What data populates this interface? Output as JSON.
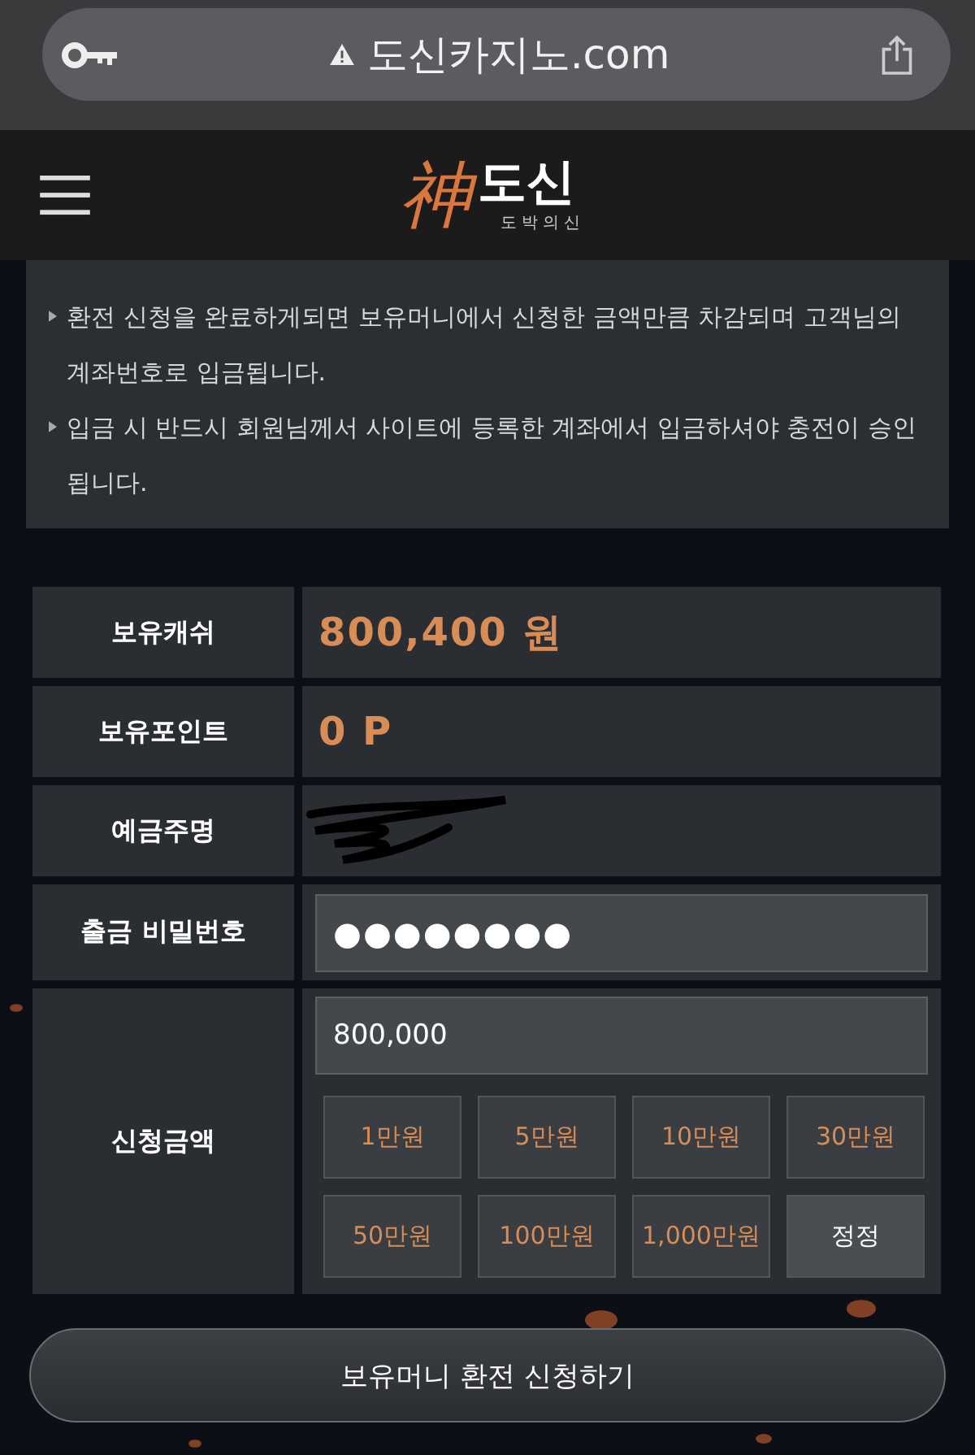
{
  "browser": {
    "url": "도신카지노.com"
  },
  "header": {
    "logo_mark": "神",
    "logo_name": "도신",
    "logo_tagline": "도박의신"
  },
  "notices": [
    "환전 신청을 완료하게되면 보유머니에서 신청한 금액만큼 차감되며 고객님의 계좌번호로 입금됩니다.",
    "입금 시 반드시 회원님께서 사이트에 등록한 계좌에서 입금하셔야 충전이 승인됩니다."
  ],
  "form": [
    {
      "kind": "value",
      "label": "보유캐쉬",
      "value": "800,400 원"
    },
    {
      "kind": "value",
      "label": "보유포인트",
      "value": "0 P"
    },
    {
      "kind": "redacted",
      "label": "예금주명"
    },
    {
      "kind": "password",
      "label": "출금 비밀번호",
      "value": "●●●●●●●●"
    },
    {
      "kind": "amount",
      "label": "신청금액",
      "value": "800,000",
      "buttons": [
        {
          "kind": "amount",
          "label": "1만원"
        },
        {
          "kind": "amount",
          "label": "5만원"
        },
        {
          "kind": "amount",
          "label": "10만원"
        },
        {
          "kind": "amount",
          "label": "30만원"
        },
        {
          "kind": "amount",
          "label": "50만원"
        },
        {
          "kind": "amount",
          "label": "100만원"
        },
        {
          "kind": "amount",
          "label": "1,000만원"
        },
        {
          "kind": "reset",
          "label": "정정"
        }
      ]
    }
  ],
  "submit": "보유머니 환전 신청하기"
}
